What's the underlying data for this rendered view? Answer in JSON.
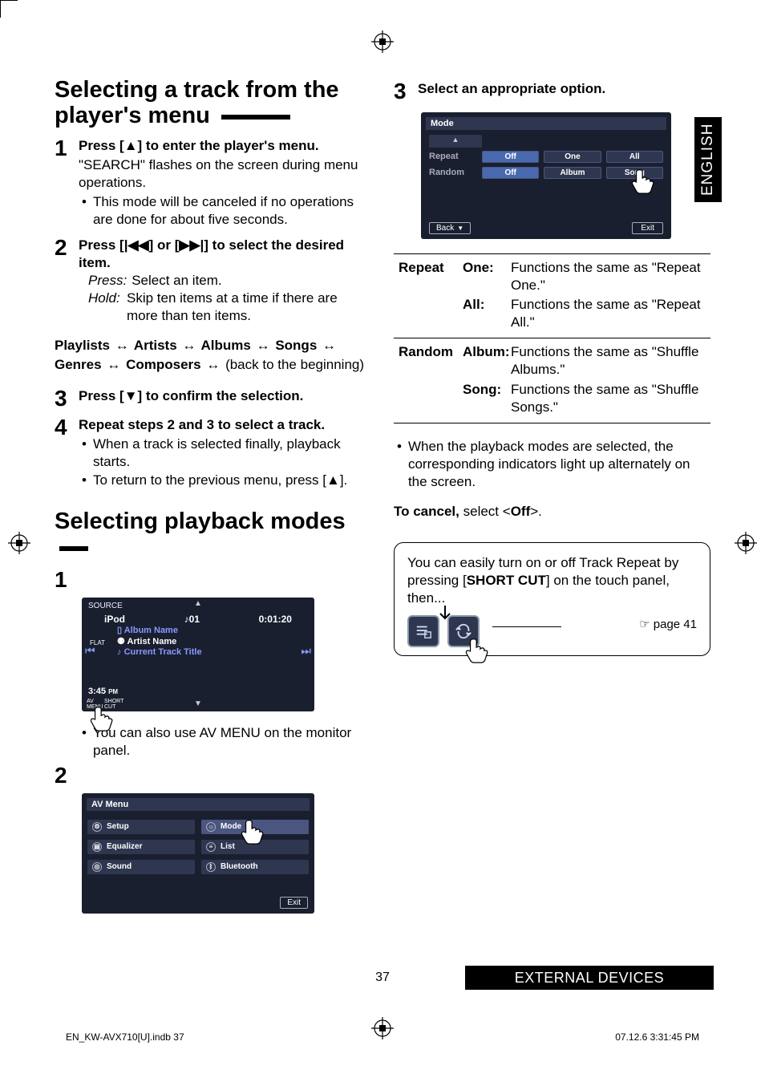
{
  "language_tab": "ENGLISH",
  "footer_bar": "EXTERNAL DEVICES",
  "page_number": "37",
  "doc_footer_left": "EN_KW-AVX710[U].indb   37",
  "doc_footer_right": "07.12.6   3:31:45 PM",
  "sec1_title": "Selecting a track from the player's menu",
  "sec1_step1_head": "Press [▲] to enter the player's menu.",
  "sec1_step1_desc": "\"SEARCH\" flashes on the screen during menu operations.",
  "sec1_step1_bullet": "This mode will be canceled if no operations are done for about five seconds.",
  "sec1_step2_head": "Press [|◀◀] or [▶▶|] to select the desired item.",
  "sec1_press_lbl": "Press:",
  "sec1_press_txt": "Select an item.",
  "sec1_hold_lbl": "Hold:",
  "sec1_hold_txt": "Skip ten items at a time if there are more than ten items.",
  "chain_p": "Playlists",
  "chain_ar": "Artists",
  "chain_al": "Albums",
  "chain_so": "Songs",
  "chain_ge": "Genres",
  "chain_co": "Composers",
  "chain_tail": "(back to the beginning)",
  "sec1_step3_head": "Press [▼] to confirm the selection.",
  "sec1_step4_head": "Repeat steps 2 and 3 to select a track.",
  "sec1_step4_b1": "When a track is selected finally, playback starts.",
  "sec1_step4_b2": "To return to the previous menu, press [▲].",
  "sec2_title": "Selecting playback modes",
  "ipod_source_lbl": "SOURCE",
  "ipod_source": "iPod",
  "ipod_track": "♪01",
  "ipod_time": "0:01:20",
  "ipod_album": "Album Name",
  "ipod_artist": "Artist Name",
  "ipod_curr": "Current Track Title",
  "ipod_clock": "3:45",
  "ipod_pm": "PM",
  "ipod_flat": "FLAT",
  "ipod_btn_av": "AV\nMENU",
  "ipod_btn_short": "SHORT\nCUT",
  "ipod_note": "You can also use AV MENU on the monitor panel.",
  "avmenu_title": "AV Menu",
  "avm_setup": "Setup",
  "avm_eq": "Equalizer",
  "avm_sound": "Sound",
  "avm_mode": "Mode",
  "avm_list": "List",
  "avm_bt": "Bluetooth",
  "avm_exit": "Exit",
  "sec3_step3_head": "Select an appropriate option.",
  "mode_title": "Mode",
  "mode_repeat": "Repeat",
  "mode_random": "Random",
  "mode_off": "Off",
  "mode_one": "One",
  "mode_all": "All",
  "mode_album": "Album",
  "mode_song": "Song",
  "mode_back": "Back",
  "mode_exit": "Exit",
  "tbl_repeat": "Repeat",
  "tbl_repeat_one_k": "One:",
  "tbl_repeat_one_v": "Functions the same as \"Repeat One.\"",
  "tbl_repeat_all_k": "All:",
  "tbl_repeat_all_v": "Functions the same as \"Repeat All.\"",
  "tbl_random": "Random",
  "tbl_random_alb_k": "Album:",
  "tbl_random_alb_v": "Functions the same as \"Shuffle Albums.\"",
  "tbl_random_song_k": "Song:",
  "tbl_random_song_v": "Functions the same as \"Shuffle Songs.\"",
  "note_playback": "When the playback modes are selected, the corresponding indicators light up alternately on the screen.",
  "cancel_pre": "To cancel,",
  "cancel_post": " select <",
  "cancel_off": "Off",
  "cancel_end": ">.",
  "tip_text_a": "You can easily turn on or off Track Repeat by pressing [",
  "tip_text_b": "SHORT CUT",
  "tip_text_c": "] on the touch panel, then...",
  "tip_page": "☞ page 41",
  "icons": {
    "album_prefix": "▯",
    "artist_prefix": "⚉",
    "track_prefix": "♪"
  }
}
